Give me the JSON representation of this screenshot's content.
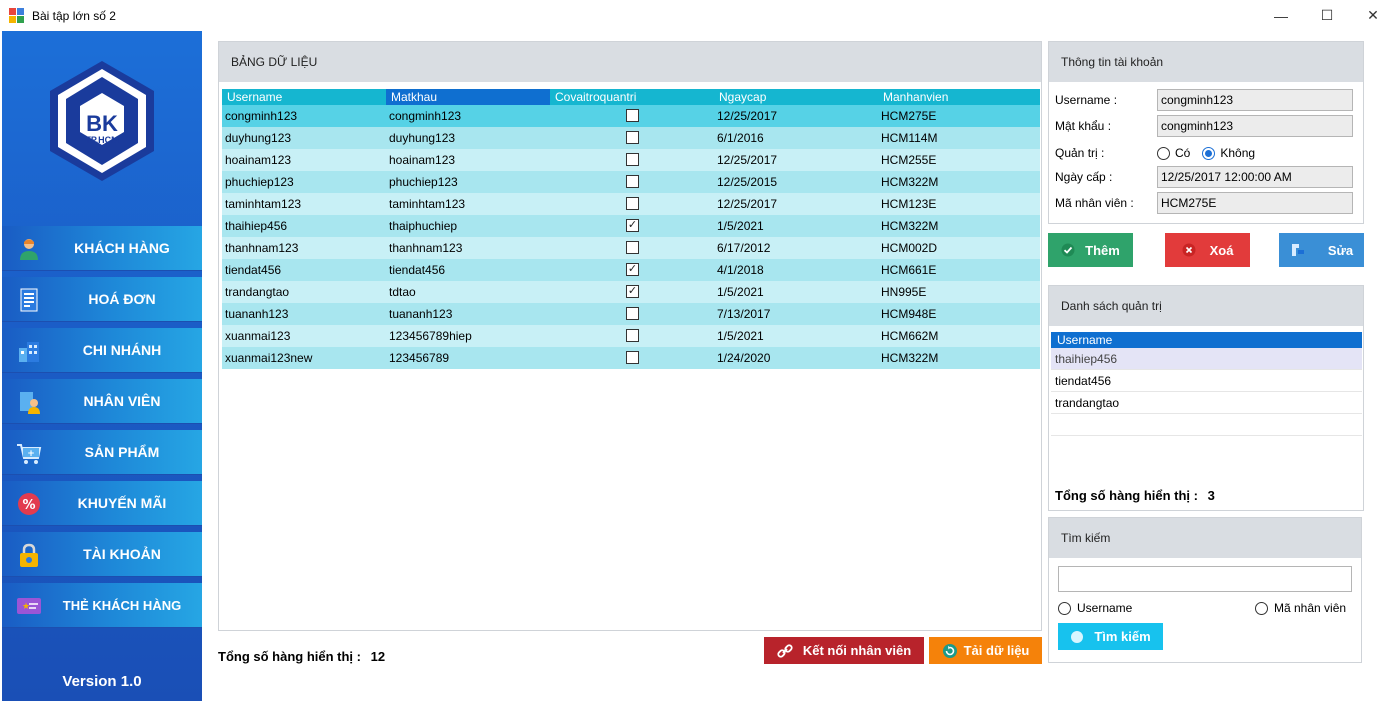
{
  "window": {
    "title": "Bài tập lớn số 2",
    "controls": [
      "—",
      "☐",
      "✕"
    ]
  },
  "sidebar": {
    "logo_text": "BK",
    "logo_subtext": "TP.HCM",
    "items": [
      {
        "label": "KHÁCH HÀNG",
        "icon": "customer-icon"
      },
      {
        "label": "HOÁ ĐƠN",
        "icon": "invoice-icon"
      },
      {
        "label": "CHI NHÁNH",
        "icon": "branch-icon"
      },
      {
        "label": "NHÂN VIÊN",
        "icon": "employee-icon"
      },
      {
        "label": "SẢN PHẨM",
        "icon": "cart-icon"
      },
      {
        "label": "KHUYẾN MÃI",
        "icon": "discount-icon"
      },
      {
        "label": "TÀI KHOẢN",
        "icon": "lock-icon"
      },
      {
        "label": "THẺ KHÁCH HÀNG",
        "icon": "card-icon"
      }
    ],
    "version": "Version 1.0"
  },
  "data_panel": {
    "title": "BẢNG DỮ LIỆU",
    "columns": [
      "Username",
      "Matkhau",
      "Covaitroquantri",
      "Ngaycap",
      "Manhanvien"
    ],
    "rows": [
      {
        "username": "congminh123",
        "password": "congminh123",
        "admin": false,
        "date": "12/25/2017",
        "employee": "HCM275E"
      },
      {
        "username": "duyhung123",
        "password": "duyhung123",
        "admin": false,
        "date": "6/1/2016",
        "employee": "HCM114M"
      },
      {
        "username": "hoainam123",
        "password": "hoainam123",
        "admin": false,
        "date": "12/25/2017",
        "employee": "HCM255E"
      },
      {
        "username": "phuchiep123",
        "password": "phuchiep123",
        "admin": false,
        "date": "12/25/2015",
        "employee": "HCM322M"
      },
      {
        "username": "taminhtam123",
        "password": "taminhtam123",
        "admin": false,
        "date": "12/25/2017",
        "employee": "HCM123E"
      },
      {
        "username": "thaihiep456",
        "password": "thaiphuchiep",
        "admin": true,
        "date": "1/5/2021",
        "employee": "HCM322M"
      },
      {
        "username": "thanhnam123",
        "password": "thanhnam123",
        "admin": false,
        "date": "6/17/2012",
        "employee": "HCM002D"
      },
      {
        "username": "tiendat456",
        "password": "tiendat456",
        "admin": true,
        "date": "4/1/2018",
        "employee": "HCM661E"
      },
      {
        "username": "trandangtao",
        "password": "tdtao",
        "admin": true,
        "date": "1/5/2021",
        "employee": "HN995E"
      },
      {
        "username": "tuananh123",
        "password": "tuananh123",
        "admin": false,
        "date": "7/13/2017",
        "employee": "HCM948E"
      },
      {
        "username": "xuanmai123",
        "password": "123456789hiep",
        "admin": false,
        "date": "1/5/2021",
        "employee": "HCM662M"
      },
      {
        "username": "xuanmai123new",
        "password": "123456789",
        "admin": false,
        "date": "1/24/2020",
        "employee": "HCM322M"
      }
    ],
    "row_count_label": "Tổng số hàng hiển thị :",
    "row_count": "12",
    "connect_button": "Kết nối nhân viên",
    "reload_button": "Tải dữ liệu"
  },
  "account_info": {
    "title": "Thông tin tài khoản",
    "username_label": "Username :",
    "username_value": "congminh123",
    "password_label": "Mật khẩu :",
    "password_value": "congminh123",
    "admin_label": "Quản trị :",
    "admin_yes": "Có",
    "admin_no": "Không",
    "admin_selected": "Không",
    "date_label": "Ngày cấp :",
    "date_value": "12/25/2017 12:00:00 AM",
    "employee_label": "Mã nhân viên :",
    "employee_value": "HCM275E"
  },
  "actions": {
    "add": "Thêm",
    "delete": "Xoá",
    "edit": "Sửa"
  },
  "admin_list": {
    "title": "Danh sách quản trị",
    "column": "Username",
    "rows": [
      "thaihiep456",
      "tiendat456",
      "trandangtao"
    ],
    "count_label": "Tổng số hàng hiển thị :",
    "count": "3"
  },
  "search": {
    "title": "Tìm kiếm",
    "query": "",
    "option_username": "Username",
    "option_employee": "Mã nhân viên",
    "button": "Tìm kiếm"
  },
  "colors": {
    "sidebar": "#1b5ec8",
    "grid_header": "#15b6d0",
    "grid_selected_col": "#0f6fd0",
    "btn_add": "#2fa36b",
    "btn_delete": "#e23b3b",
    "btn_edit": "#3a8fd6",
    "btn_connect": "#b8232b",
    "btn_reload": "#f5820a",
    "btn_search": "#17c2ee"
  }
}
